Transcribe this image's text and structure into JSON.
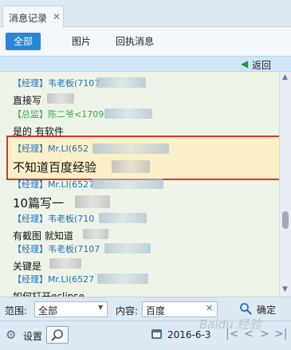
{
  "tab": {
    "label": "消息记录",
    "close": "✕"
  },
  "filters": [
    {
      "label": "全部",
      "active": true
    },
    {
      "label": "图片",
      "active": false
    },
    {
      "label": "回执消息",
      "active": false
    }
  ],
  "history": {
    "back_label": "返回",
    "back_icon": "arrow-left-icon"
  },
  "messages": [
    {
      "header": "【经理】韦老板(7107",
      "body": "直接写"
    },
    {
      "header": "【总监】陈二爷<1709",
      "body": "是的 有软件"
    },
    {
      "header": "【经理】Mr.LI(652",
      "body": "不知道百度经验"
    },
    {
      "header": "【经理】Mr.LI(6527",
      "body": "10篇写一"
    },
    {
      "header": "【经理】韦老板(710",
      "body": "有截图 就知道"
    },
    {
      "header": "【经理】韦老板(7107",
      "body": "关键是"
    },
    {
      "header": "【经理】Mr.LI(6527",
      "body": "如何打开eclipse"
    }
  ],
  "search": {
    "scope_label": "范围:",
    "scope_value": "全部",
    "content_label": "内容:",
    "content_value": "百度",
    "clear": "✕",
    "submit_label": "确定"
  },
  "toolbar": {
    "settings_label": "设置",
    "date": "2016-6-3",
    "watermark": "Baidu 经验"
  },
  "colors": {
    "accent": "#2a86d9",
    "highlight_border": "#e0302a",
    "manager": "#1e6fc2",
    "director": "#3aa34a"
  }
}
